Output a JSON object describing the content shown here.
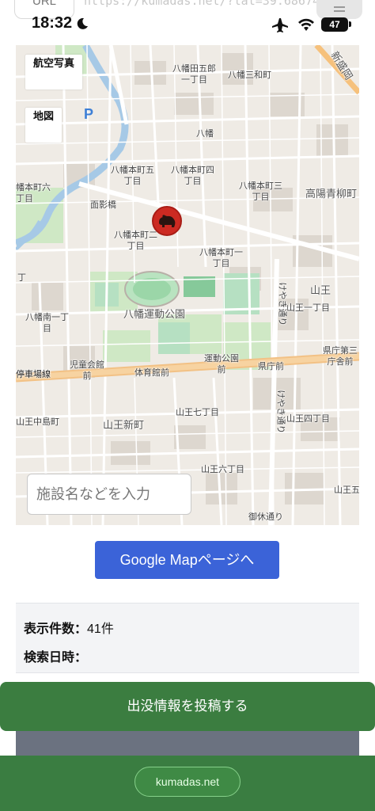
{
  "browser": {
    "url_label": "URL",
    "url_text": "https://kumadas.net/?lat=39.68674"
  },
  "status_bar": {
    "time": "18:32",
    "battery": "47"
  },
  "map": {
    "layer_buttons": {
      "aerial": "航空写真",
      "map": "地図"
    },
    "search_placeholder": "施設名などを入力",
    "labels": {
      "l1": "八幡田五郎",
      "l1b": "一丁目",
      "l2": "八幡三和町",
      "l3": "新盛岡",
      "l4": "八幡",
      "l5": "八幡本町五",
      "l5b": "丁目",
      "l6": "八幡本町四",
      "l6b": "丁目",
      "l7": "八幡本町三",
      "l7b": "丁目",
      "l8": "高陽青柳町",
      "l9": "幡本町六",
      "l9b": "丁目",
      "l10": "面影橋",
      "l11": "八幡本町二",
      "l11b": "丁目",
      "l12": "八幡本町一",
      "l12b": "丁目",
      "l13": "山王",
      "l14": "山王一丁目",
      "l15": "八幡運動公園",
      "l16": "八幡南一丁",
      "l16b": "目",
      "l17": "県庁第三",
      "l17b": "庁舎前",
      "l18": "停車場線",
      "l19": "児童会館",
      "l19b": "前",
      "l20": "体育館前",
      "l21": "運動公園",
      "l21b": "前",
      "l22": "県庁前",
      "l23": "山王七丁目",
      "l24": "山王四丁目",
      "l25": "山王中島町",
      "l26": "山王新町",
      "l27": "山王六丁目",
      "l28": "山王五",
      "l29": "御休通り",
      "l30": "けやき通り",
      "l31": "けやき通り",
      "l32": "丁"
    }
  },
  "google_map_button": "Google Mapページへ",
  "info": {
    "count_label": "表示件数：",
    "count_value": "41件",
    "date_label": "検索日時："
  },
  "post_button": "出没情報を投稿する",
  "footer": {
    "domain": "kumadas.net"
  },
  "colors": {
    "accent_blue": "#3b63d8",
    "green": "#3b7d40",
    "marker_red": "#cc2a22"
  }
}
